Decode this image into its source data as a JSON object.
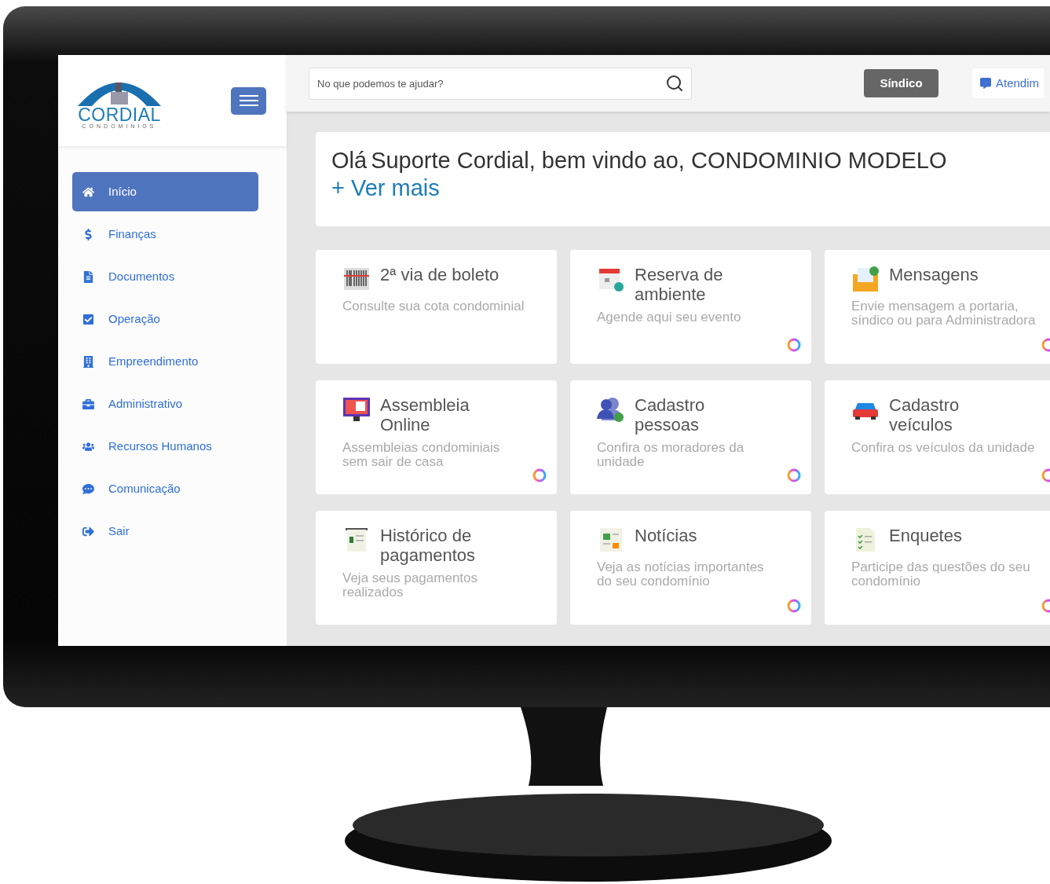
{
  "logo": {
    "name": "CORDIAL",
    "tagline": "CONDOMINIOS"
  },
  "sidebar": {
    "items": [
      {
        "label": "Início",
        "selected": true
      },
      {
        "label": "Finanças",
        "selected": false
      },
      {
        "label": "Documentos",
        "selected": false
      },
      {
        "label": "Operação",
        "selected": false
      },
      {
        "label": "Empreendimento",
        "selected": false
      },
      {
        "label": "Administrativo",
        "selected": false
      },
      {
        "label": "Recursos Humanos",
        "selected": false
      },
      {
        "label": "Comunicação",
        "selected": false
      },
      {
        "label": "Sair",
        "selected": false
      }
    ]
  },
  "header": {
    "search": {
      "placeholder": "No que podemos te ajudar?"
    },
    "role_button": "Síndico",
    "support_button": "Atendim"
  },
  "welcome": {
    "greeting": "Olá",
    "text": "Suporte Cordial, bem vindo ao, CONDOMINIO MODELO",
    "link": "+ Ver mais"
  },
  "cards": [
    {
      "title": "2ª via de boleto",
      "description": "Consulte sua cota condominial",
      "chat": false
    },
    {
      "title": "Reserva de ambiente",
      "description": "Agende aqui seu evento",
      "chat": true
    },
    {
      "title": "Mensagens",
      "description": "Envie mensagem a portaria, síndico ou para Administradora",
      "chat": true
    },
    {
      "title": "Assembleia Online",
      "description": "Assembleias condominiais sem sair de casa",
      "chat": true
    },
    {
      "title": "Cadastro pessoas",
      "description": "Confira os moradores da unidade",
      "chat": true
    },
    {
      "title": "Cadastro veículos",
      "description": "Confira os veículos da unidade",
      "chat": true
    },
    {
      "title": "Histórico de pagamentos",
      "description": "Veja seus pagamentos realizados",
      "chat": false
    },
    {
      "title": "Notícias",
      "description": "Veja as notícias importantes do seu condomínio",
      "chat": true
    },
    {
      "title": "Enquetes",
      "description": "Participe das questões do seu condomínio",
      "chat": true
    }
  ]
}
